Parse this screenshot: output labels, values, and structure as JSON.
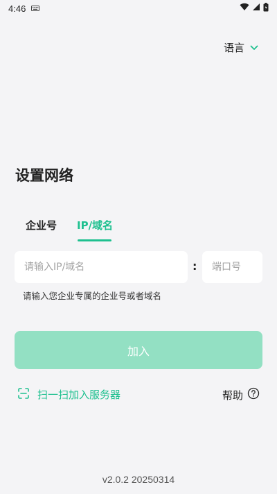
{
  "status_bar": {
    "time": "4:46",
    "icons": [
      "keyboard-icon",
      "wifi-icon",
      "cell-signal-icon",
      "battery-icon"
    ]
  },
  "language": {
    "label": "语言",
    "icon": "chevron-down-icon"
  },
  "page_title": "设置网络",
  "tabs": [
    {
      "label": "企业号",
      "active": false
    },
    {
      "label": "IP/域名",
      "active": true
    }
  ],
  "form": {
    "ip_placeholder": "请输入IP/域名",
    "separator": ":",
    "port_placeholder": "端口号",
    "hint": "请输入您企业专属的企业号或者域名"
  },
  "join_button": {
    "label": "加入"
  },
  "scan": {
    "label": "扫一扫加入服务器",
    "icon": "scan-icon"
  },
  "help": {
    "label": "帮助",
    "icon": "help-circle-icon"
  },
  "version": "v2.0.2 20250314",
  "colors": {
    "accent": "#1ec08f",
    "button_disabled": "#93e0c3",
    "background": "#f4f4f6"
  }
}
